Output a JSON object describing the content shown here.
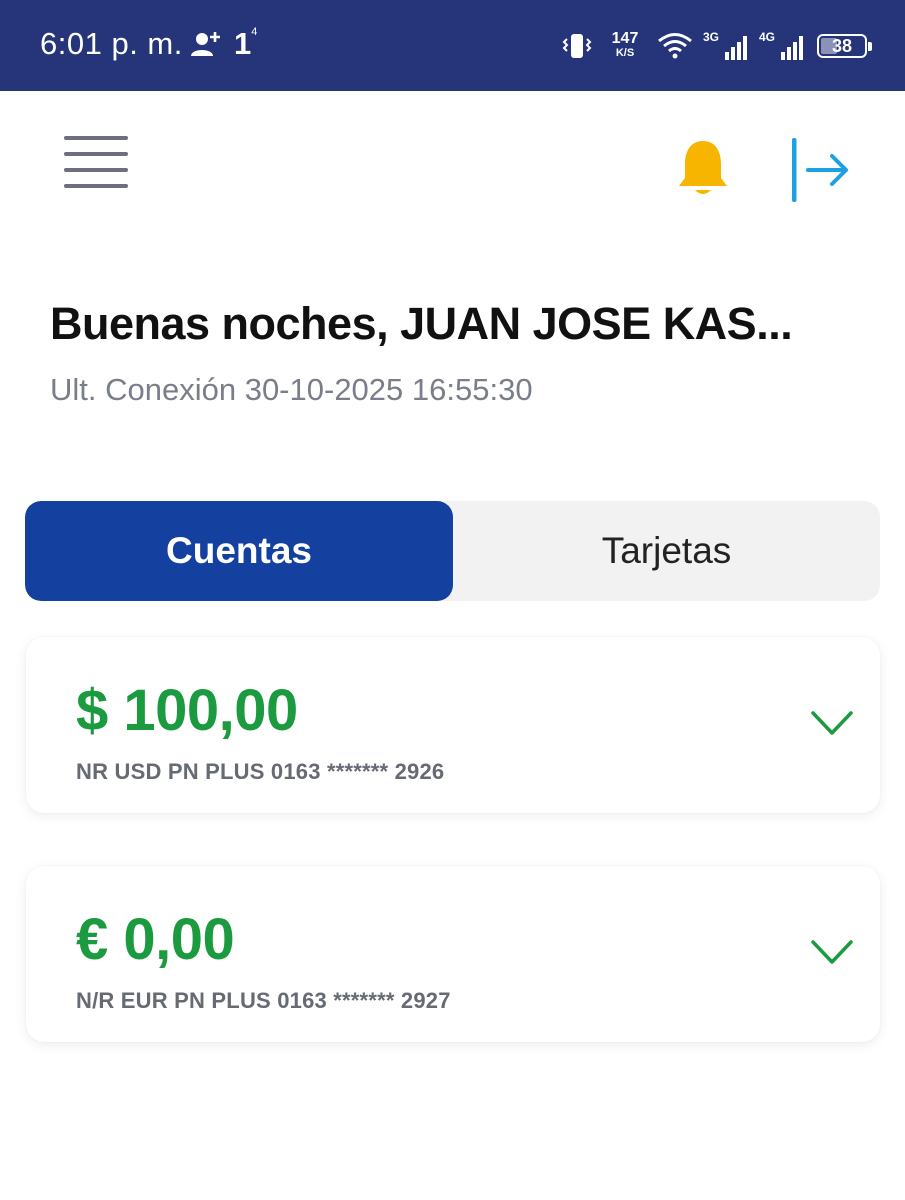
{
  "status_bar": {
    "time": "6:01 p. m.",
    "notification_count": "1",
    "notification_sup": "4",
    "net_speed_value": "147",
    "net_speed_unit": "K/S",
    "sim1_label": "3G",
    "sim2_label": "4G",
    "battery_level": "38",
    "background_color": "#26357a"
  },
  "header": {
    "menu_icon": "hamburger-menu-icon",
    "bell_icon": "bell-icon",
    "bell_color": "#f7b500",
    "logout_icon": "logout-arrow-icon",
    "logout_color": "#1da1e2"
  },
  "greeting": {
    "text": "Buenas noches, JUAN JOSE KAS...",
    "last_connection": "Ult. Conexión 30-10-2025 16:55:30"
  },
  "tabs": [
    {
      "label": "Cuentas",
      "active": true
    },
    {
      "label": "Tarjetas",
      "active": false
    }
  ],
  "accounts": [
    {
      "amount": "$ 100,00",
      "account_label": "NR USD PN PLUS 0163 ******* 2926"
    },
    {
      "amount": "€ 0,00",
      "account_label": "N/R EUR PN PLUS 0163 ******* 2927"
    }
  ],
  "colors": {
    "accent_blue": "#1441a0",
    "amount_green": "#1b9a3f"
  }
}
